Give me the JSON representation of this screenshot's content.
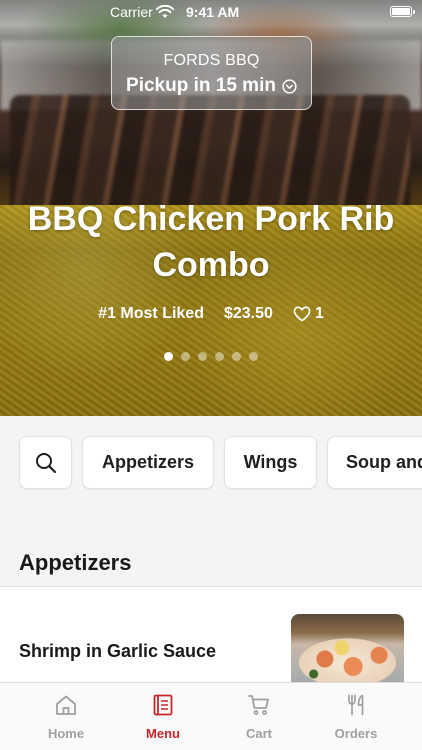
{
  "status_bar": {
    "carrier": "Carrier",
    "time": "9:41 AM"
  },
  "store": {
    "name": "FORDS BBQ",
    "pickup": "Pickup in 15 min"
  },
  "featured": {
    "title": "BBQ Chicken Pork Rib Combo",
    "rank": "#1 Most Liked",
    "price": "$23.50",
    "likes": "1",
    "slides": 6,
    "active_slide": 1
  },
  "categories": [
    "Appetizers",
    "Wings",
    "Soup and"
  ],
  "section": {
    "title": "Appetizers"
  },
  "items": [
    {
      "name": "Shrimp in Garlic Sauce"
    }
  ],
  "tabs": [
    {
      "label": "Home",
      "icon": "home-icon",
      "active": false
    },
    {
      "label": "Menu",
      "icon": "menu-icon",
      "active": true
    },
    {
      "label": "Cart",
      "icon": "cart-icon",
      "active": false
    },
    {
      "label": "Orders",
      "icon": "fork-knife-icon",
      "active": false
    }
  ],
  "colors": {
    "accent": "#c8262c",
    "inactive_tab": "#a0a0a0",
    "background": "#f4f4f4"
  }
}
